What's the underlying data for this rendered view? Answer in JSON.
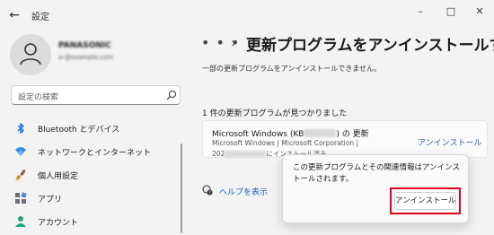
{
  "window": {
    "title": "設定",
    "back_glyph": "←",
    "minimize_glyph": "–",
    "maximize_glyph": "□",
    "close_glyph": "✕"
  },
  "profile": {
    "name": "PANASONIC",
    "email": "a-@example.com"
  },
  "search": {
    "placeholder": "設定の検索"
  },
  "sidebar": {
    "items": [
      {
        "label": "Bluetooth とデバイス",
        "icon": "bluetooth-icon"
      },
      {
        "label": "ネットワークとインターネット",
        "icon": "wifi-icon"
      },
      {
        "label": "個人用設定",
        "icon": "brush-icon"
      },
      {
        "label": "アプリ",
        "icon": "apps-icon"
      },
      {
        "label": "アカウント",
        "icon": "account-icon"
      }
    ]
  },
  "main": {
    "breadcrumb_more": "• • •",
    "breadcrumb_sep": "›",
    "title": "更新プログラムをアンインストールす",
    "subtitle": "一部の更新プログラムをアンインストールできません。",
    "count_text": "1 件の更新プログラムが見つかりました",
    "update": {
      "name_prefix": "Microsoft Windows (KB",
      "name_suffix": ") の 更新",
      "meta": "Microsoft Windows  |  Microsoft Corporation  |",
      "date_prefix": "202",
      "date_suffix": "にインストール済み",
      "uninstall_label": "アンインストール"
    },
    "help_label": "ヘルプを表示"
  },
  "flyout": {
    "message": "この更新プログラムとその関連情報はアンインストールされます。",
    "confirm_label": "アンインストール"
  },
  "colors": {
    "accent": "#1f5fbf",
    "highlight_box": "#e3001b",
    "bluetooth": "#1a73e8"
  }
}
